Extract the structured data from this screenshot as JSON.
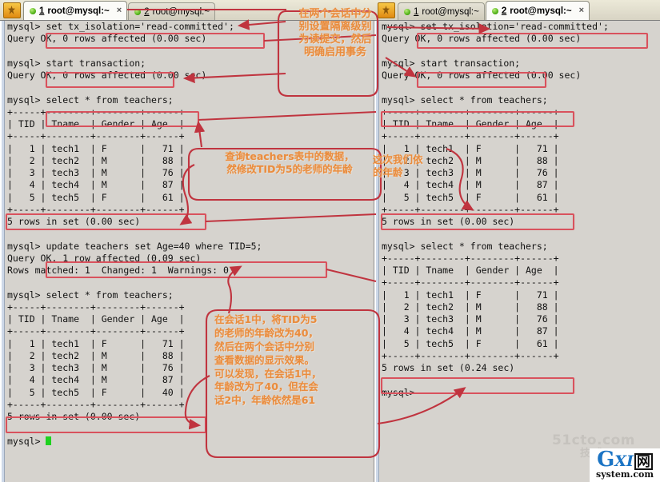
{
  "window": {
    "title": "root@mysql:~",
    "app_icon": "terminal-app-icon"
  },
  "tabbars": {
    "left": {
      "tabs": [
        {
          "num": "1",
          "label": " root@mysql:~",
          "active": true,
          "close": "×",
          "led": "green-led-icon"
        },
        {
          "num": "2",
          "label": " root@mysql:~",
          "active": false,
          "close": "",
          "led": "green-led-icon"
        }
      ]
    },
    "right": {
      "tabs": [
        {
          "num": "1",
          "label": " root@mysql:~",
          "active": false,
          "close": "",
          "led": "green-led-icon"
        },
        {
          "num": "2",
          "label": " root@mysql:~",
          "active": true,
          "close": "×",
          "led": "green-led-icon"
        }
      ]
    }
  },
  "session1": {
    "name": "session-1-terminal",
    "lines": [
      "mysql> set tx_isolation='read-committed';",
      "Query OK, 0 rows affected (0.00 sec)",
      "",
      "mysql> start transaction;",
      "Query OK, 0 rows affected (0.00 sec)",
      "",
      "mysql> select * from teachers;",
      "+-----+--------+--------+------+",
      "| TID | Tname  | Gender | Age  |",
      "+-----+--------+--------+------+",
      "|   1 | tech1  | F      |   71 |",
      "|   2 | tech2  | M      |   88 |",
      "|   3 | tech3  | M      |   76 |",
      "|   4 | tech4  | M      |   87 |",
      "|   5 | tech5  | F      |   61 |",
      "+-----+--------+--------+------+",
      "5 rows in set (0.00 sec)",
      "",
      "mysql> update teachers set Age=40 where TID=5;",
      "Query OK, 1 row affected (0.09 sec)",
      "Rows matched: 1  Changed: 1  Warnings: 0",
      "",
      "mysql> select * from teachers;",
      "+-----+--------+--------+------+",
      "| TID | Tname  | Gender | Age  |",
      "+-----+--------+--------+------+",
      "|   1 | tech1  | F      |   71 |",
      "|   2 | tech2  | M      |   88 |",
      "|   3 | tech3  | M      |   76 |",
      "|   4 | tech4  | M      |   87 |",
      "|   5 | tech5  | F      |   40 |",
      "+-----+--------+--------+------+",
      "5 rows in set (0.00 sec)",
      ""
    ],
    "prompt": "mysql> "
  },
  "session2": {
    "name": "session-2-terminal",
    "lines": [
      "mysql> set tx_isolation='read-committed';",
      "Query OK, 0 rows affected (0.00 sec)",
      "",
      "mysql> start transaction;",
      "Query OK, 0 rows affected (0.00 sec)",
      "",
      "mysql> select * from teachers;",
      "+-----+--------+--------+------+",
      "| TID | Tname  | Gender | Age  |",
      "+-----+--------+--------+------+",
      "|   1 | tech1  | F      |   71 |",
      "|   2 | tech2  | M      |   88 |",
      "|   3 | tech3  | M      |   76 |",
      "|   4 | tech4  | M      |   87 |",
      "|   5 | tech5  | F      |   61 |",
      "+-----+--------+--------+------+",
      "5 rows in set (0.00 sec)",
      "",
      "mysql> select * from teachers;",
      "+-----+--------+--------+------+",
      "| TID | Tname  | Gender | Age  |",
      "+-----+--------+--------+------+",
      "|   1 | tech1  | F      |   71 |",
      "|   2 | tech2  | M      |   88 |",
      "|   3 | tech3  | M      |   76 |",
      "|   4 | tech4  | M      |   87 |",
      "|   5 | tech5  | F      |   61 |",
      "+-----+--------+--------+------+",
      "5 rows in set (0.24 sec)",
      ""
    ],
    "prompt": "mysql> "
  },
  "annotations": {
    "color": "#e98c3e",
    "box_color": "#c03a46",
    "texts": {
      "t1": "在两个会话中分\n别设置隔离级别\n为读提交，然后\n明确启用事务",
      "t2": "查询teachers表中的数据，\n然修改TID为5的老师的年龄",
      "t3": "这次我们依\n的年龄",
      "t4": "在会话1中，将TID为5\n的老师的年龄改为40，\n然后在两个会话中分别\n查看数据的显示效果。\n可以发现，在会话1中，\n年龄改为了40，但在会\n话2中，年龄依然是61"
    }
  },
  "watermarks": {
    "site": "51cto.com",
    "site_sub": "技术",
    "logo_g": "G",
    "logo_xi": "XI",
    "logo_wang": "网",
    "logo_sub": "system.com"
  }
}
